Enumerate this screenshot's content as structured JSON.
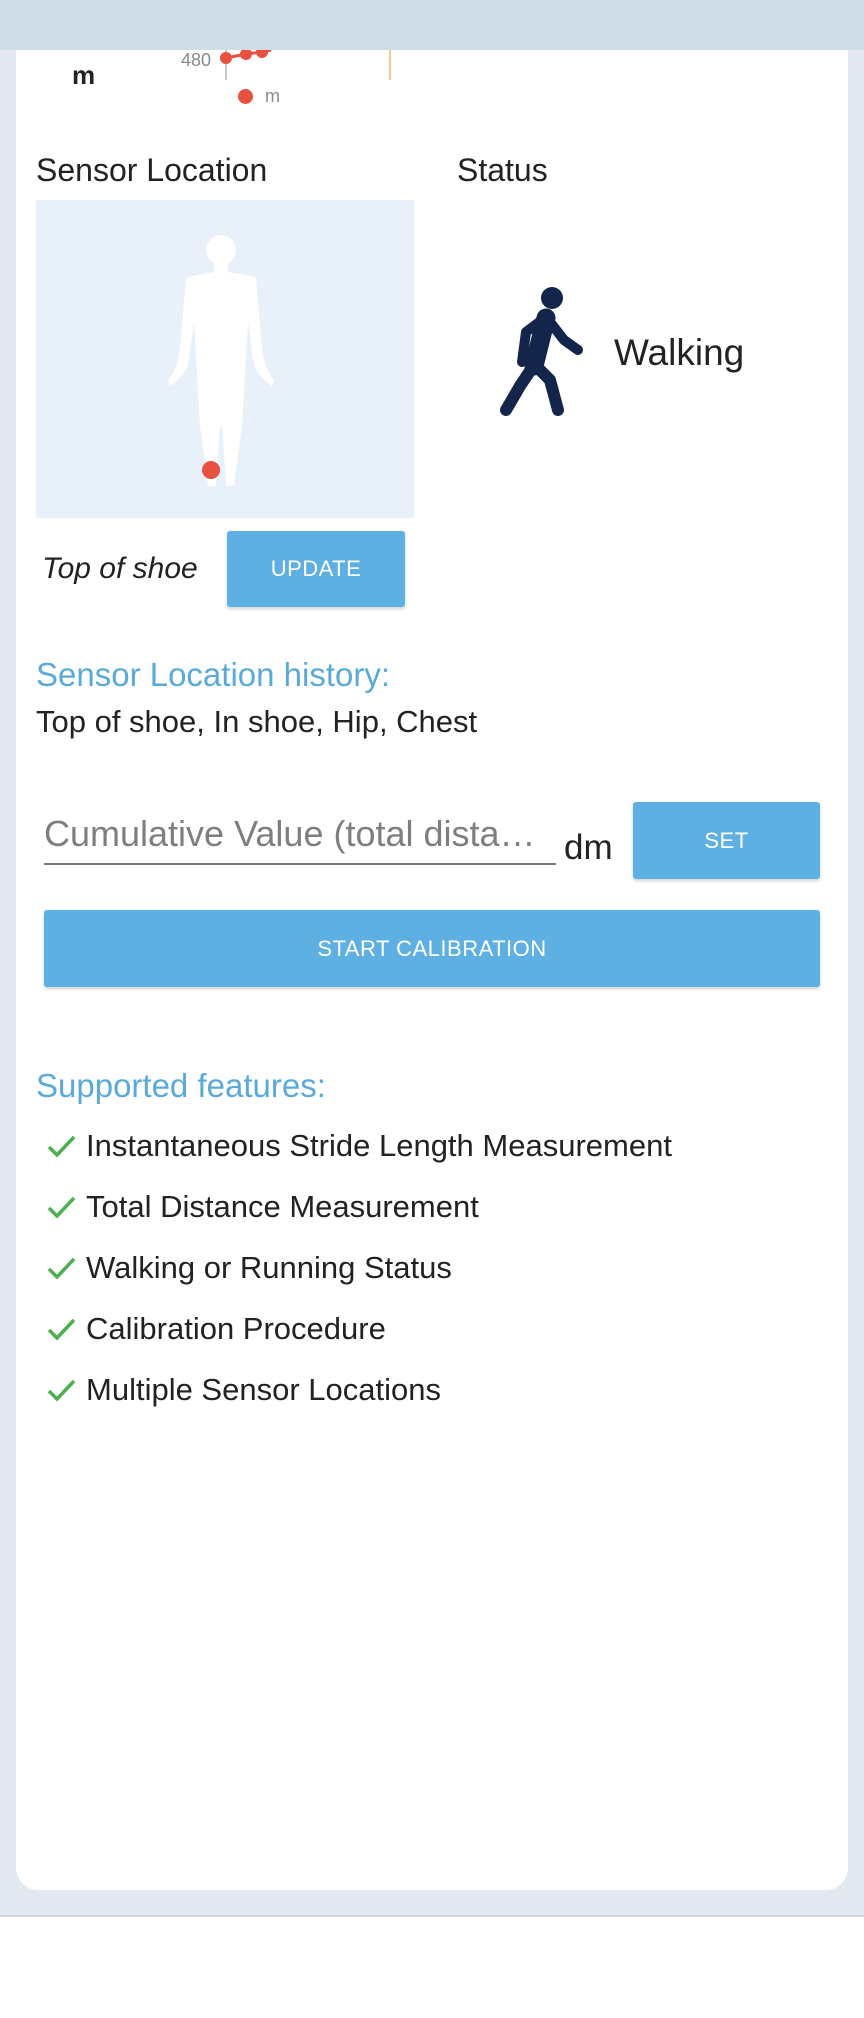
{
  "chart": {
    "unit_label": "m",
    "tick_label": "480",
    "legend_label": "m",
    "series_color": "#e8513f"
  },
  "sensor_location": {
    "heading": "Sensor Location",
    "current_value": "Top of shoe",
    "update_label": "UPDATE"
  },
  "status": {
    "heading": "Status",
    "value": "Walking",
    "icon": "walking-person-icon"
  },
  "history": {
    "heading": "Sensor Location history:",
    "items_text": "Top of shoe, In shoe, Hip, Chest"
  },
  "cumulative": {
    "placeholder": "Cumulative Value (total dista…",
    "unit": "dm",
    "set_label": "SET"
  },
  "calibration": {
    "button_label": "START CALIBRATION"
  },
  "features": {
    "heading": "Supported features:",
    "items": [
      {
        "label": "Instantaneous Stride Length Measurement"
      },
      {
        "label": "Total Distance Measurement"
      },
      {
        "label": "Walking or Running Status"
      },
      {
        "label": "Calibration Procedure"
      },
      {
        "label": "Multiple Sensor Locations"
      }
    ]
  },
  "colors": {
    "accent": "#5fb0e2",
    "heading_blue": "#5aaad9",
    "check_green": "#4caf50",
    "sensor_dot": "#e8513f",
    "walker": "#13254a"
  }
}
